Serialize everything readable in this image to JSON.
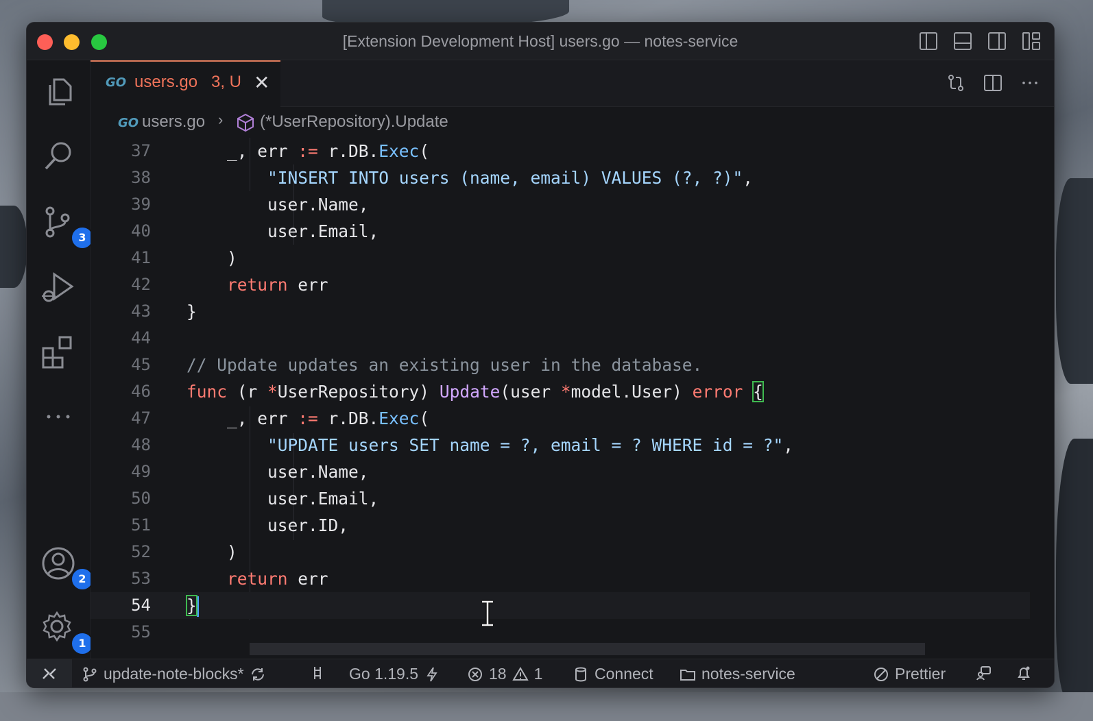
{
  "window": {
    "title": "[Extension Development Host] users.go — notes-service"
  },
  "activity_bar": {
    "items": [
      {
        "name": "explorer",
        "icon": "files-icon"
      },
      {
        "name": "search",
        "icon": "search-icon"
      },
      {
        "name": "source-control",
        "icon": "source-control-icon",
        "badge": "3"
      },
      {
        "name": "run-and-debug",
        "icon": "run-debug-icon"
      },
      {
        "name": "extensions",
        "icon": "extensions-icon"
      },
      {
        "name": "more",
        "icon": "ellipsis-icon"
      }
    ],
    "accounts_badge": "2",
    "settings_badge": "1"
  },
  "tab": {
    "icon_text": "GO",
    "label": "users.go",
    "status": "3, U",
    "close_glyph": "✕"
  },
  "breadcrumb": {
    "icon_text": "GO",
    "file": "users.go",
    "separator": "›",
    "symbol": "(*UserRepository).Update"
  },
  "editor": {
    "current_line": 54,
    "line_numbers": [
      "37",
      "38",
      "39",
      "40",
      "41",
      "42",
      "43",
      "44",
      "45",
      "46",
      "47",
      "48",
      "49",
      "50",
      "51",
      "52",
      "53",
      "54",
      "55"
    ]
  },
  "status_bar": {
    "branch": "update-note-blocks*",
    "go_version": "Go 1.19.5",
    "errors": "18",
    "warnings": "1",
    "connect": "Connect",
    "folder": "notes-service",
    "prettier": "Prettier"
  },
  "colors": {
    "accent_tab": "#e07c5c",
    "badge": "#1f6feb",
    "keyword": "#ff7b72",
    "string": "#a5d6ff",
    "function": "#d2a8ff"
  }
}
